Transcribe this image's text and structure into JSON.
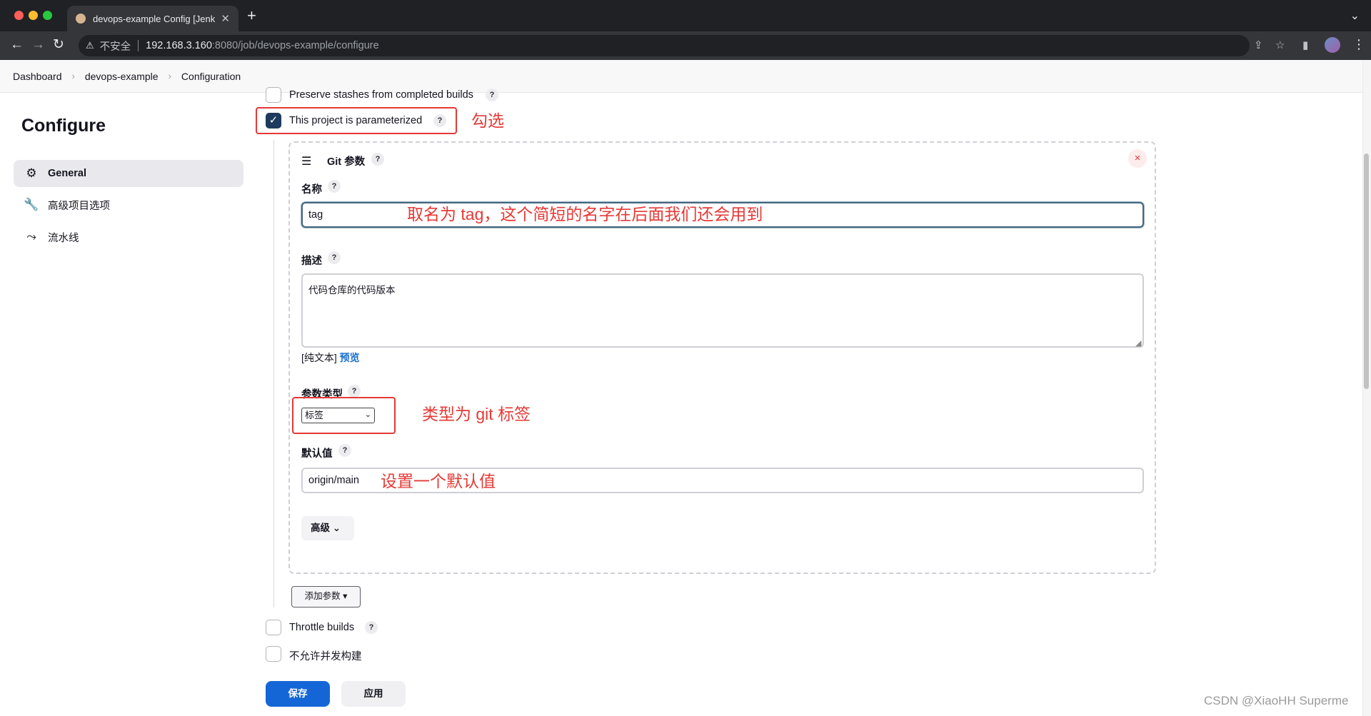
{
  "browser": {
    "tab_title": "devops-example Config [Jenkins]",
    "tab_close": "✕",
    "new_tab": "+",
    "security_label": "不安全",
    "url_host": "192.168.3.160",
    "url_path": ":8080/job/devops-example/configure"
  },
  "breadcrumb": {
    "items": [
      "Dashboard",
      "devops-example",
      "Configuration"
    ],
    "separator": "›"
  },
  "sidebar": {
    "title": "Configure",
    "items": [
      {
        "label": "General",
        "icon": "gear-icon"
      },
      {
        "label": "高级项目选项",
        "icon": "wrench-icon"
      },
      {
        "label": "流水线",
        "icon": "pipeline-icon"
      }
    ]
  },
  "options": {
    "preserve_stashes": "Preserve stashes from completed builds",
    "parameterized": "This project is parameterized",
    "throttle": "Throttle builds",
    "no_concurrent": "不允许并发构建",
    "help": "?"
  },
  "param": {
    "title": "Git 参数",
    "name_label": "名称",
    "name_value": "tag",
    "desc_label": "描述",
    "desc_value": "代码仓库的代码版本",
    "format_prefix": "[纯文本]",
    "format_preview": "预览",
    "type_label": "参数类型",
    "type_value": "标签",
    "default_label": "默认值",
    "default_value": "origin/main",
    "advanced_label": "高级",
    "close": "×"
  },
  "add_param_label": "添加参数 ▾",
  "buttons": {
    "save": "保存",
    "apply": "应用"
  },
  "annotations": {
    "check": "勾选",
    "name": "取名为 tag，这个简短的名字在后面我们还会用到",
    "type": "类型为 git 标签",
    "default": "设置一个默认值"
  },
  "watermark": "CSDN @XiaoHH Superme",
  "colors": {
    "annotation": "#e53935",
    "primary": "#1466d6",
    "checkbox": "#1d3b5e"
  }
}
